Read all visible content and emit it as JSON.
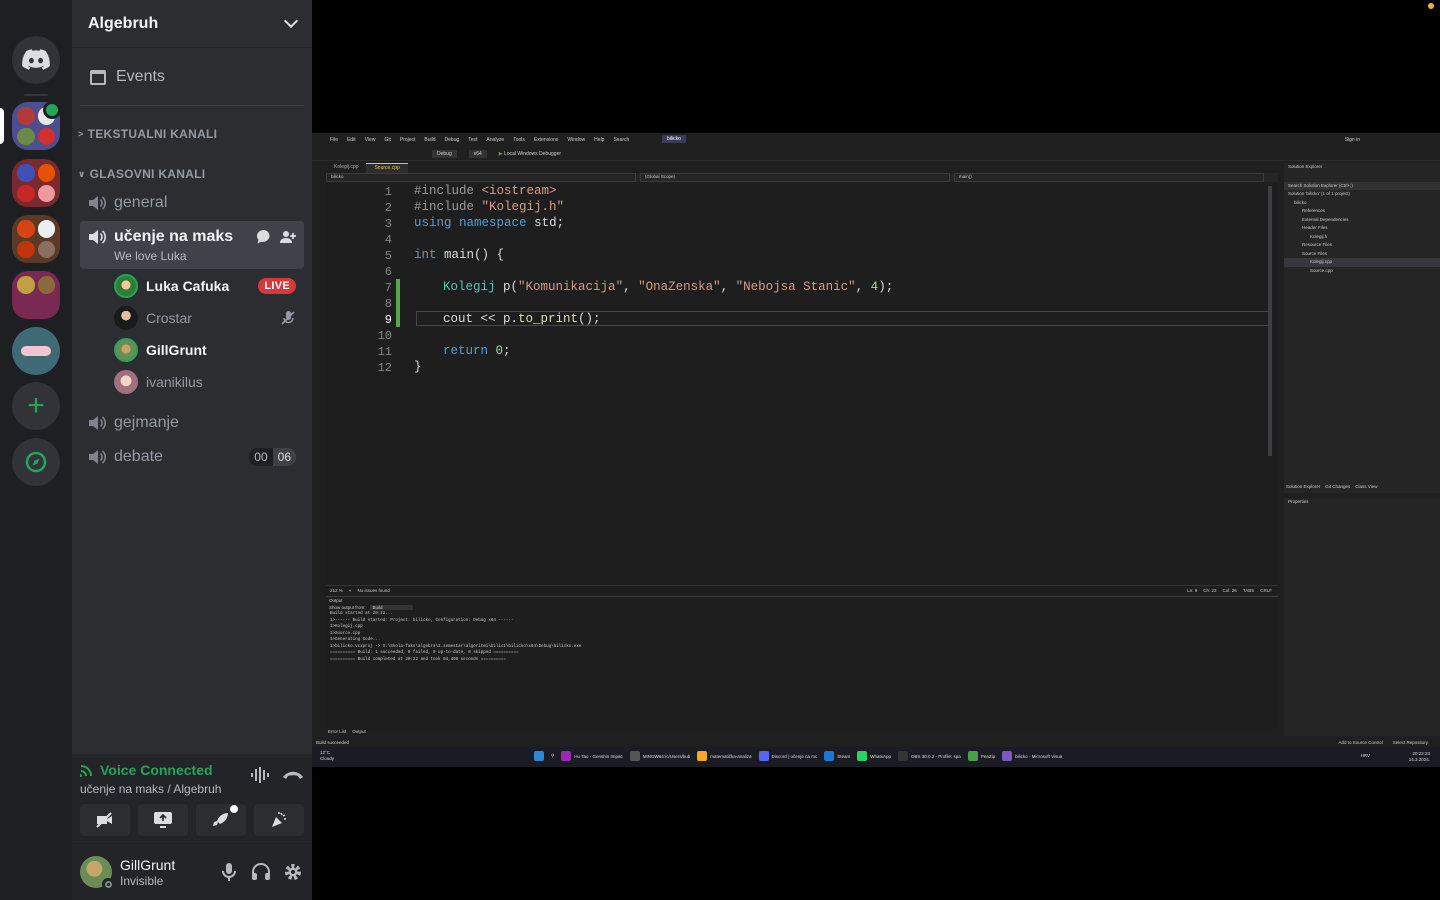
{
  "server": {
    "name": "Algebruh",
    "events_label": "Events"
  },
  "categories": {
    "text": "TEKSTUALNI KANALI",
    "voice": "GLASOVNI KANALI"
  },
  "channels": {
    "general": "general",
    "active": {
      "name": "učenje na maks",
      "status": "We love Luka"
    },
    "gejmanje": "gejmanje",
    "debate": {
      "name": "debate",
      "count_a": "00",
      "count_b": "06"
    }
  },
  "voice_users": [
    {
      "name": "Luka Cafuka",
      "badge": "LIVE"
    },
    {
      "name": "Crostar"
    },
    {
      "name": "GillGrunt"
    },
    {
      "name": "ivanikilus"
    }
  ],
  "voice_panel": {
    "status": "Voice Connected",
    "channel": "učenje na maks / Algebruh"
  },
  "user_panel": {
    "name": "GillGrunt",
    "state": "Invisible"
  },
  "icons": {
    "home": "discord-logo-icon",
    "add": "plus-icon",
    "discover": "compass-icon",
    "speaker": "speaker-icon",
    "chat": "chat-bubble-icon",
    "invite": "add-user-icon",
    "stream": "streaming-icon",
    "noise": "soundwave-icon",
    "disconnect": "phone-hangup-icon",
    "camera": "camera-off-icon",
    "share": "screen-share-icon",
    "activity": "rocket-icon",
    "soundboard": "soundboard-icon",
    "mic": "microphone-icon",
    "headphones": "headphones-icon",
    "settings": "gear-icon"
  },
  "colors": {
    "green": "#23a55a",
    "live": "#da373c",
    "sidebar": "#2b2d31",
    "rail": "#1e1f22"
  },
  "vs": {
    "menu": [
      "File",
      "Edit",
      "View",
      "Git",
      "Project",
      "Build",
      "Debug",
      "Test",
      "Analyze",
      "Tools",
      "Extensions",
      "Window",
      "Help",
      "Search"
    ],
    "solution_tag": "bilicko",
    "sign_in": "Sign in",
    "toolbar": {
      "config": "Debug",
      "platform": "x64",
      "run": "Local Windows Debugger"
    },
    "tabs": [
      "Kolegij.cpp",
      "Source.cpp"
    ],
    "nav": {
      "project": "bilicko",
      "scope": "(Global Scope)",
      "member": "main()"
    },
    "line_numbers": [
      "1",
      "2",
      "3",
      "4",
      "5",
      "6",
      "7",
      "8",
      "9",
      "10",
      "11",
      "12"
    ],
    "code": {
      "l1_pp": "#include",
      "l1_rest": "<iostream>",
      "l2_pp": "#include",
      "l2_rest": "\"Kolegij.h\"",
      "l3_kw1": "using",
      "l3_kw2": "namespace",
      "l3_rest": "std;",
      "l5_kw": "int",
      "l5_rest": "main() {",
      "l7_ty": "Kolegij",
      "l7_var": "p(",
      "l7_s1": "\"Komunikacija\"",
      "l7_s2": "\"OnaZenska\"",
      "l7_s3": "\"Nebojsa Stanic\"",
      "l7_num": "4",
      "l7_end": ");",
      "l9_a": "cout << p.",
      "l9_fn": "to_print",
      "l9_end": "();",
      "l11_kw": "return",
      "l11_num": "0",
      "l11_end": ";",
      "l12": "}"
    },
    "status_editor": {
      "zoom": "212 %",
      "issues": "No issues found",
      "ln": "Ln: 9",
      "ch": "Ch: 23",
      "col": "Col: 26",
      "tabs": "TABS",
      "crlf": "CRLF"
    },
    "output": {
      "title": "Output",
      "show_from": "Show output from:",
      "source": "Build",
      "lines": [
        "Build started at 20:22...",
        "1>------ Build started: Project: bilicko, Configuration: Debug x64 ------",
        "1>Kolegij.cpp",
        "1>Source.cpp",
        "1>Generating Code...",
        "1>bilicko.vcxproj -> X:\\Skola-faks\\algebra\\2.semestar\\algoritmi\\bilic1\\bilicko\\x64\\Debug\\bilicko.exe",
        "========== Build: 1 succeeded, 0 failed, 0 up-to-date, 0 skipped ==========",
        "========== Build completed at 20:22 and took 04,408 seconds =========="
      ],
      "tabs": [
        "Error List",
        "Output"
      ]
    },
    "solution_explorer": {
      "title": "Solution Explorer",
      "search": "Search Solution Explorer (Ctrl+;)",
      "items": [
        "Solution 'bilicko' (1 of 1 project)",
        "bilicko",
        "References",
        "External Dependencies",
        "Header Files",
        "Kolegij.h",
        "Resource Files",
        "Source Files",
        "Kolegij.cpp",
        "Source.cpp"
      ],
      "tabs": [
        "Solution Explorer",
        "Git Changes",
        "Class View"
      ]
    },
    "properties_title": "Properties",
    "statusbar": {
      "left": "Build succeeded",
      "source_control": "Add to Source Control",
      "repo": "Select Repository"
    },
    "taskbar": {
      "weather_temp": "12°C",
      "weather_desc": "Cloudy",
      "apps": [
        "Hu Tao - Genshin Impac",
        "MINGW64:/c/Users/bub",
        "matematička-analiza",
        "Discord | učenje na mc",
        "Steam",
        "WhatsApp",
        "OBS 30.0.2 - Profile: spa",
        "PeaZip",
        "bilicko - Microsoft Visua"
      ],
      "lang": "HRV",
      "time": "20:22:23",
      "date": "14.3.2024."
    }
  }
}
